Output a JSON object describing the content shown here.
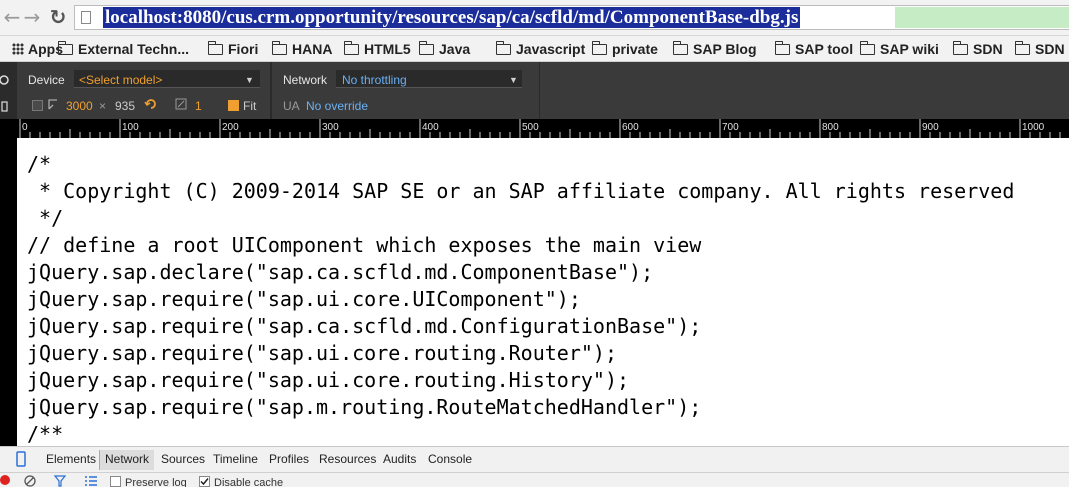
{
  "address_bar": {
    "url": "localhost:8080/cus.crm.opportunity/resources/sap/ca/scfld/md/ComponentBase-dbg.js",
    "back_glyph": "←",
    "forward_glyph": "→",
    "reload_glyph": "↻"
  },
  "bookmarks": [
    {
      "label": "Apps",
      "icon": "apps-grid-icon"
    },
    {
      "label": "External Techn...",
      "icon": "folder-icon"
    },
    {
      "label": "Fiori",
      "icon": "folder-icon"
    },
    {
      "label": "HANA",
      "icon": "folder-icon"
    },
    {
      "label": "HTML5",
      "icon": "folder-icon"
    },
    {
      "label": "Java",
      "icon": "folder-icon"
    },
    {
      "label": "Javascript",
      "icon": "folder-icon"
    },
    {
      "label": "private",
      "icon": "folder-icon"
    },
    {
      "label": "SAP Blog",
      "icon": "folder-icon"
    },
    {
      "label": "SAP tool",
      "icon": "folder-icon"
    },
    {
      "label": "SAP wiki",
      "icon": "folder-icon"
    },
    {
      "label": "SDN",
      "icon": "folder-icon"
    },
    {
      "label": "SDN",
      "icon": "folder-icon"
    }
  ],
  "emulation": {
    "device_label": "Device",
    "device_value": "<Select model>",
    "width": "3000",
    "times": "×",
    "height": "935",
    "scale": "1",
    "fit_label": "Fit",
    "network_label": "Network",
    "network_value": "No throttling",
    "ua_label": "UA",
    "ua_value": "No override"
  },
  "ruler": {
    "labels": [
      "0",
      "100",
      "200",
      "300",
      "400",
      "500",
      "600",
      "700",
      "800",
      "900",
      "1000"
    ]
  },
  "code_lines": [
    "/*",
    " * Copyright (C) 2009-2014 SAP SE or an SAP affiliate company. All rights reserved",
    " */",
    "// define a root UIComponent which exposes the main view",
    "jQuery.sap.declare(\"sap.ca.scfld.md.ComponentBase\");",
    "jQuery.sap.require(\"sap.ui.core.UIComponent\");",
    "jQuery.sap.require(\"sap.ca.scfld.md.ConfigurationBase\");",
    "jQuery.sap.require(\"sap.ui.core.routing.Router\");",
    "jQuery.sap.require(\"sap.ui.core.routing.History\");",
    "jQuery.sap.require(\"sap.m.routing.RouteMatchedHandler\");",
    "/**"
  ],
  "devtools_tabs": [
    "Elements",
    "Network",
    "Sources",
    "Timeline",
    "Profiles",
    "Resources",
    "Audits",
    "Console"
  ],
  "active_tab": "Network",
  "network_toolbar": {
    "preserve_log": "Preserve log",
    "disable_cache": "Disable cache"
  },
  "colors": {
    "url_highlight": "#1b2d9a",
    "device_orange": "#f0a030",
    "network_blue": "#6ab0f5"
  }
}
